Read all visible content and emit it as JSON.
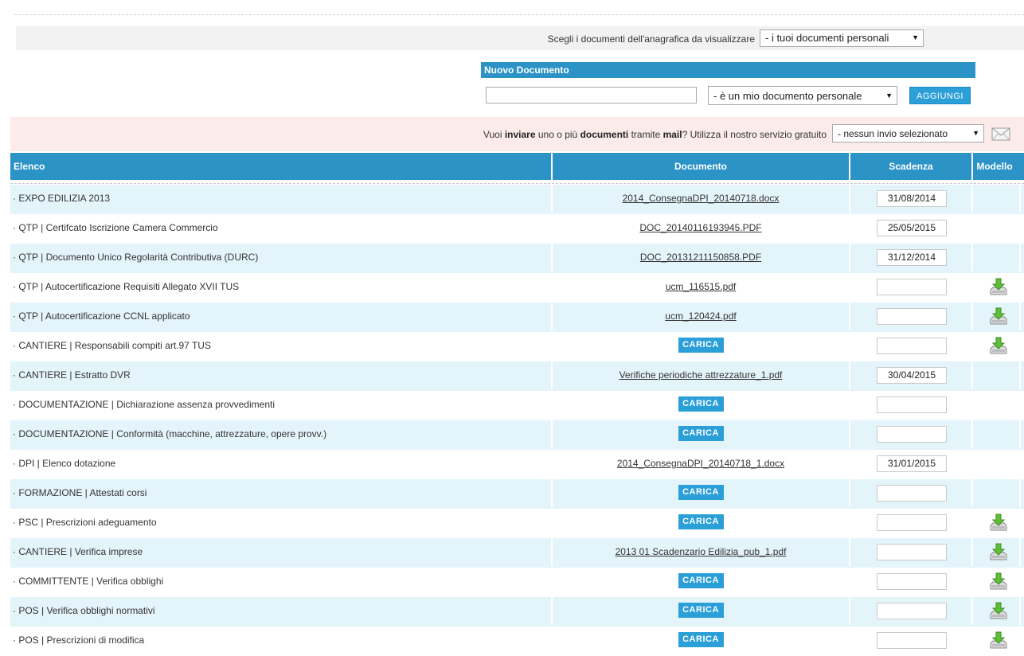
{
  "filter": {
    "label": "Scegli i documenti dell'anagrafica da visualizzare",
    "selected": "- i tuoi documenti personali"
  },
  "new_document": {
    "header": "Nuovo Documento",
    "input_value": "",
    "type_selected": "- è un mio documento personale",
    "add_label": "AGGIUNGI"
  },
  "mail": {
    "text_1": "Vuoi ",
    "text_bold_1": "inviare",
    "text_2": " uno o più ",
    "text_bold_2": "documenti",
    "text_3": " tramite ",
    "text_bold_3": "mail",
    "text_4": "? Utilizza il nostro servizio gratuito",
    "selected": "- nessun invio selezionato",
    "icon": "envelope-icon"
  },
  "table": {
    "headers": {
      "elenco": "Elenco",
      "documento": "Documento",
      "scadenza": "Scadenza",
      "modello": "Modello"
    },
    "upload_label": "CARICA",
    "rows": [
      {
        "name": "· EXPO EDILIZIA 2013",
        "document": "2014_ConsegnaDPI_20140718.docx",
        "deadline": "31/08/2014",
        "model": false
      },
      {
        "name": "· QTP | Certifcato Iscrizione Camera Commercio",
        "document": "DOC_20140116193945.PDF",
        "deadline": "25/05/2015",
        "model": false
      },
      {
        "name": "· QTP | Documento Unico Regolarità Contributiva (DURC)",
        "document": "DOC_20131211150858.PDF",
        "deadline": "31/12/2014",
        "model": false
      },
      {
        "name": "· QTP | Autocertificazione Requisiti Allegato XVII TUS",
        "document": "ucm_116515.pdf",
        "deadline": "",
        "model": true
      },
      {
        "name": "· QTP | Autocertificazione CCNL applicato",
        "document": "ucm_120424.pdf",
        "deadline": "",
        "model": true
      },
      {
        "name": "· CANTIERE | Responsabili compiti art.97 TUS",
        "document": "",
        "deadline": "",
        "model": true
      },
      {
        "name": "· CANTIERE | Estratto DVR",
        "document": "Verifiche periodiche attrezzature_1.pdf",
        "deadline": "30/04/2015",
        "model": false
      },
      {
        "name": "· DOCUMENTAZIONE | Dichiarazione assenza provvedimenti",
        "document": "",
        "deadline": "",
        "model": false
      },
      {
        "name": "· DOCUMENTAZIONE | Conformità (macchine, attrezzature, opere provv.)",
        "document": "",
        "deadline": "",
        "model": false
      },
      {
        "name": "· DPI | Elenco dotazione",
        "document": "2014_ConsegnaDPI_20140718_1.docx",
        "deadline": "31/01/2015",
        "model": false
      },
      {
        "name": "· FORMAZIONE | Attestati corsi",
        "document": "",
        "deadline": "",
        "model": false
      },
      {
        "name": "· PSC | Prescrizioni adeguamento",
        "document": "",
        "deadline": "",
        "model": true
      },
      {
        "name": "· CANTIERE | Verifica imprese",
        "document": "2013 01 Scadenzario Edilizia_pub_1.pdf",
        "deadline": "",
        "model": true
      },
      {
        "name": "· COMMITTENTE | Verifica obblighi",
        "document": "",
        "deadline": "",
        "model": true
      },
      {
        "name": "· POS | Verifica obblighi normativi",
        "document": "",
        "deadline": "",
        "model": true
      },
      {
        "name": "· POS | Prescrizioni di modifica",
        "document": "",
        "deadline": "",
        "model": true
      }
    ]
  },
  "colors": {
    "header_blue": "#2b93c6",
    "button_blue": "#2b9fd8",
    "row_alt": "#e4f4fb",
    "mail_bar": "#fbecea"
  }
}
